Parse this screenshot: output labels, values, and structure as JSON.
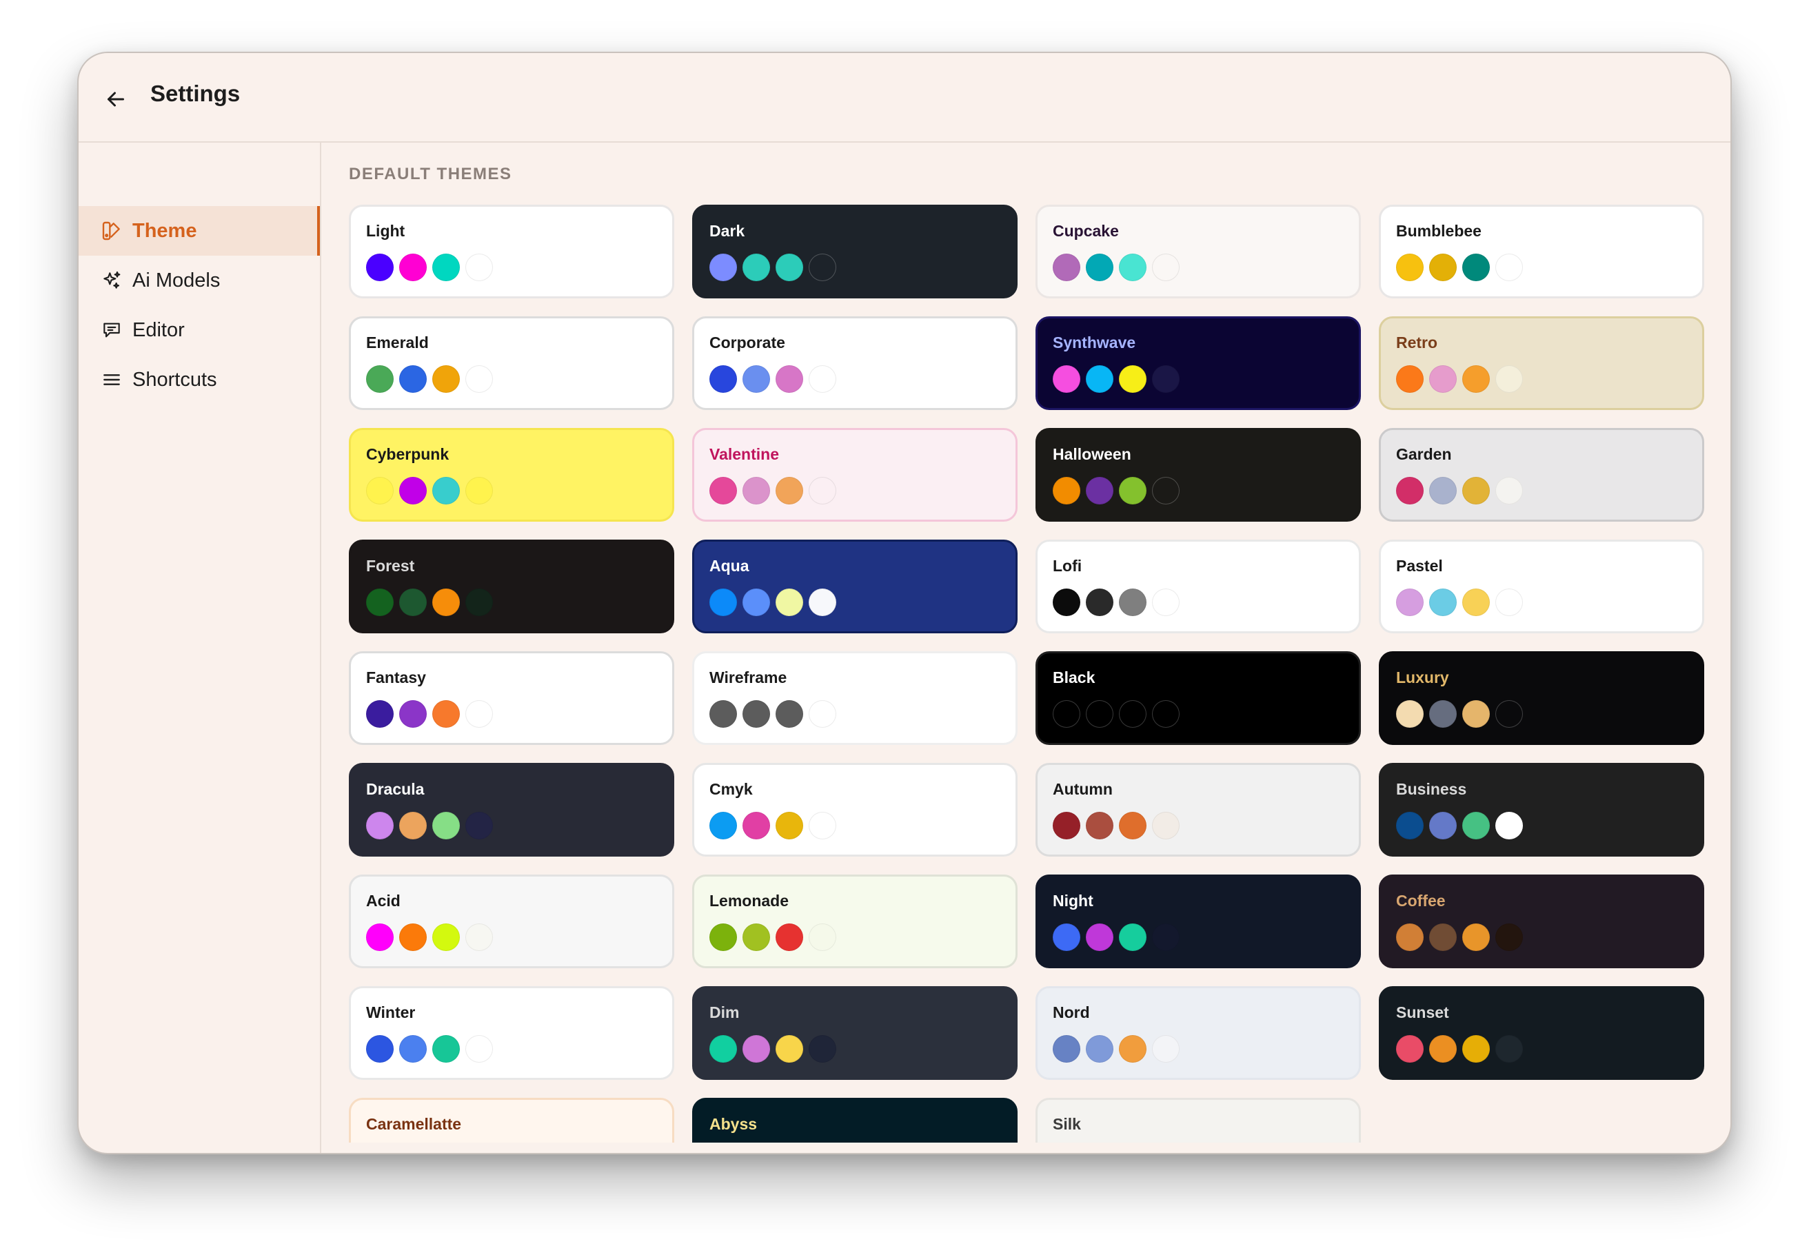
{
  "header": {
    "title": "Settings"
  },
  "sidebar": {
    "items": [
      {
        "label": "Theme",
        "icon": "theme-icon"
      },
      {
        "label": "Ai Models",
        "icon": "sparkles-icon"
      },
      {
        "label": "Editor",
        "icon": "chat-icon"
      },
      {
        "label": "Shortcuts",
        "icon": "menu-icon"
      }
    ],
    "active": "Theme"
  },
  "section": {
    "title": "DEFAULT THEMES"
  },
  "themes": [
    {
      "name": "Light",
      "bg": "#ffffff",
      "border": "#e8e6e6",
      "text": "#1a1a1a",
      "swatches": [
        "#4a00ff",
        "#ff00d3",
        "#00d7c0",
        "#ffffff"
      ]
    },
    {
      "name": "Dark",
      "bg": "#1d232a",
      "border": "#1d232a",
      "text": "#ffffff",
      "swatches": [
        "#7c8cff",
        "#2cccb9",
        "#2cccb9",
        "#1d232a"
      ]
    },
    {
      "name": "Cupcake",
      "bg": "#faf7f5",
      "border": "#ebe6e4",
      "text": "#291334",
      "swatches": [
        "#b16ab8",
        "#02a8b5",
        "#49e4d2",
        "#faf7f5"
      ]
    },
    {
      "name": "Bumblebee",
      "bg": "#ffffff",
      "border": "#e8e6e6",
      "text": "#1a1a1a",
      "swatches": [
        "#f7c10f",
        "#e3b007",
        "#00897b",
        "#ffffff"
      ]
    },
    {
      "name": "Emerald",
      "bg": "#ffffff",
      "border": "#dcdcdc",
      "text": "#1a1a1a",
      "swatches": [
        "#4aa957",
        "#2b66e3",
        "#f0a40a",
        "#ffffff"
      ]
    },
    {
      "name": "Corporate",
      "bg": "#ffffff",
      "border": "#dcdcdc",
      "text": "#1a1a1a",
      "swatches": [
        "#2846dd",
        "#6a8fef",
        "#d776c7",
        "#ffffff"
      ]
    },
    {
      "name": "Synthwave",
      "bg": "#0b0533",
      "border": "#1b1462",
      "text": "#a6b4ff",
      "swatches": [
        "#f54ee0",
        "#08b6f5",
        "#f7ee17",
        "#1a1646"
      ]
    },
    {
      "name": "Retro",
      "bg": "#ece3cb",
      "border": "#dccf9e",
      "text": "#7a3e1a",
      "swatches": [
        "#fb7919",
        "#e69ccc",
        "#f59e2c",
        "#f4efdb"
      ]
    },
    {
      "name": "Cyberpunk",
      "bg": "#fff363",
      "border": "#f5e54f",
      "text": "#1a1a1a",
      "swatches": [
        "#fff34d",
        "#c100e8",
        "#38cdcd",
        "#fff34d"
      ]
    },
    {
      "name": "Valentine",
      "bg": "#fbeff3",
      "border": "#f4c6d9",
      "text": "#c0145d",
      "swatches": [
        "#e5489a",
        "#db93cb",
        "#f1a459",
        "#fbeff3"
      ]
    },
    {
      "name": "Halloween",
      "bg": "#1b1a17",
      "border": "#1b1a17",
      "text": "#ffffff",
      "swatches": [
        "#f28c00",
        "#6b30a2",
        "#84c12d",
        "#1b1a17"
      ]
    },
    {
      "name": "Garden",
      "bg": "#e8e7e8",
      "border": "#cbcacb",
      "text": "#1a1a1a",
      "swatches": [
        "#d22e68",
        "#a9b2cd",
        "#e2b337",
        "#f4f3f0"
      ]
    },
    {
      "name": "Forest",
      "bg": "#1b1717",
      "border": "#1b1717",
      "text": "#dadada",
      "swatches": [
        "#14621f",
        "#1d5830",
        "#f68d0a",
        "#13241a"
      ]
    },
    {
      "name": "Aqua",
      "bg": "#1f3383",
      "border": "#0f1f5a",
      "text": "#ffffff",
      "swatches": [
        "#0c8af9",
        "#5b8ffa",
        "#f0f7a3",
        "#f7f8fb"
      ]
    },
    {
      "name": "Lofi",
      "bg": "#ffffff",
      "border": "#e8e8e8",
      "text": "#1a1a1a",
      "swatches": [
        "#0c0c0c",
        "#2a2a2a",
        "#7f7f7f",
        "#ffffff"
      ]
    },
    {
      "name": "Pastel",
      "bg": "#ffffff",
      "border": "#e8e8e8",
      "text": "#1a1a1a",
      "swatches": [
        "#d69ee0",
        "#6bcce5",
        "#f8d156",
        "#ffffff"
      ]
    },
    {
      "name": "Fantasy",
      "bg": "#ffffff",
      "border": "#dcdcdc",
      "text": "#1a1a1a",
      "swatches": [
        "#3a1c9e",
        "#8b35c8",
        "#f7792c",
        "#ffffff"
      ]
    },
    {
      "name": "Wireframe",
      "bg": "#ffffff",
      "border": "#eeeeee",
      "text": "#1a1a1a",
      "swatches": [
        "#5c5c5c",
        "#5c5c5c",
        "#5c5c5c",
        "#ffffff"
      ]
    },
    {
      "name": "Black",
      "bg": "#000000",
      "border": "#1e1e1e",
      "text": "#ffffff",
      "swatches": [
        "#000000",
        "#000000",
        "#000000",
        "#000000"
      ]
    },
    {
      "name": "Luxury",
      "bg": "#0a0a0c",
      "border": "#0a0a0c",
      "text": "#e2b86a",
      "swatches": [
        "#f3dbb0",
        "#666d7f",
        "#e5b56b",
        "#0a0a0c"
      ]
    },
    {
      "name": "Dracula",
      "bg": "#282a36",
      "border": "#282a36",
      "text": "#ffffff",
      "swatches": [
        "#cd86ed",
        "#eca45d",
        "#86de86",
        "#232445"
      ]
    },
    {
      "name": "Cmyk",
      "bg": "#ffffff",
      "border": "#e6e6e6",
      "text": "#1a1a1a",
      "swatches": [
        "#0c9cf2",
        "#e13fa4",
        "#e8b60c",
        "#ffffff"
      ]
    },
    {
      "name": "Autumn",
      "bg": "#f1f1f1",
      "border": "#dcdcdc",
      "text": "#1a1a1a",
      "swatches": [
        "#952028",
        "#aa4e3f",
        "#df6e2c",
        "#f2ece6"
      ]
    },
    {
      "name": "Business",
      "bg": "#202020",
      "border": "#202020",
      "text": "#dadada",
      "swatches": [
        "#0b4d8f",
        "#6479c8",
        "#46c183",
        "#ffffff"
      ]
    },
    {
      "name": "Acid",
      "bg": "#f7f7f7",
      "border": "#e2e2e2",
      "text": "#1a1a1a",
      "swatches": [
        "#ff00fb",
        "#fb7a0a",
        "#d3f90f",
        "#f7f7f2"
      ]
    },
    {
      "name": "Lemonade",
      "bg": "#f6faec",
      "border": "#dfe2d6",
      "text": "#1a1a1a",
      "swatches": [
        "#7cb20c",
        "#a1c121",
        "#e63230",
        "#f5f9ea"
      ]
    },
    {
      "name": "Night",
      "bg": "#111828",
      "border": "#111828",
      "text": "#ffffff",
      "swatches": [
        "#3d6af5",
        "#bf38d9",
        "#16cd9d",
        "#13182d"
      ]
    },
    {
      "name": "Coffee",
      "bg": "#221a24",
      "border": "#221a24",
      "text": "#d8a670",
      "swatches": [
        "#d17f36",
        "#704c34",
        "#e8952a",
        "#23150e"
      ]
    },
    {
      "name": "Winter",
      "bg": "#ffffff",
      "border": "#e8e8e8",
      "text": "#1a1a1a",
      "swatches": [
        "#2c56e1",
        "#4b80ef",
        "#17c697",
        "#ffffff"
      ]
    },
    {
      "name": "Dim",
      "bg": "#2b303c",
      "border": "#2b303c",
      "text": "#dadada",
      "swatches": [
        "#11cfa0",
        "#cf76d7",
        "#f8d54a",
        "#1f2538"
      ]
    },
    {
      "name": "Nord",
      "bg": "#eceff4",
      "border": "#e3e6ec",
      "text": "#1a1a1a",
      "swatches": [
        "#6782c4",
        "#7f9ad9",
        "#f19d3d",
        "#f3f4f7"
      ]
    },
    {
      "name": "Sunset",
      "bg": "#131b21",
      "border": "#131b21",
      "text": "#dadada",
      "swatches": [
        "#e94c67",
        "#eb8f22",
        "#e6ae06",
        "#1e272e"
      ]
    },
    {
      "name": "Caramellatte",
      "bg": "#fff6ee",
      "border": "#f7dcc2",
      "text": "#7a3312",
      "swatches": [
        "#d06c46",
        "#e0a067",
        "#eeb049",
        "#fff6ee"
      ]
    },
    {
      "name": "Abyss",
      "bg": "#031c26",
      "border": "#031c26",
      "text": "#f5e18c",
      "swatches": [
        "#e8e438",
        "#d0d0ff",
        "#4d5b5c",
        "#0f2a30"
      ]
    },
    {
      "name": "Silk",
      "bg": "#f4f3f0",
      "border": "#e6e4e0",
      "text": "#3b3b3b",
      "swatches": [
        "#5b55ef",
        "#d678d7",
        "#f2b53f",
        "#f4f3f0"
      ]
    }
  ]
}
